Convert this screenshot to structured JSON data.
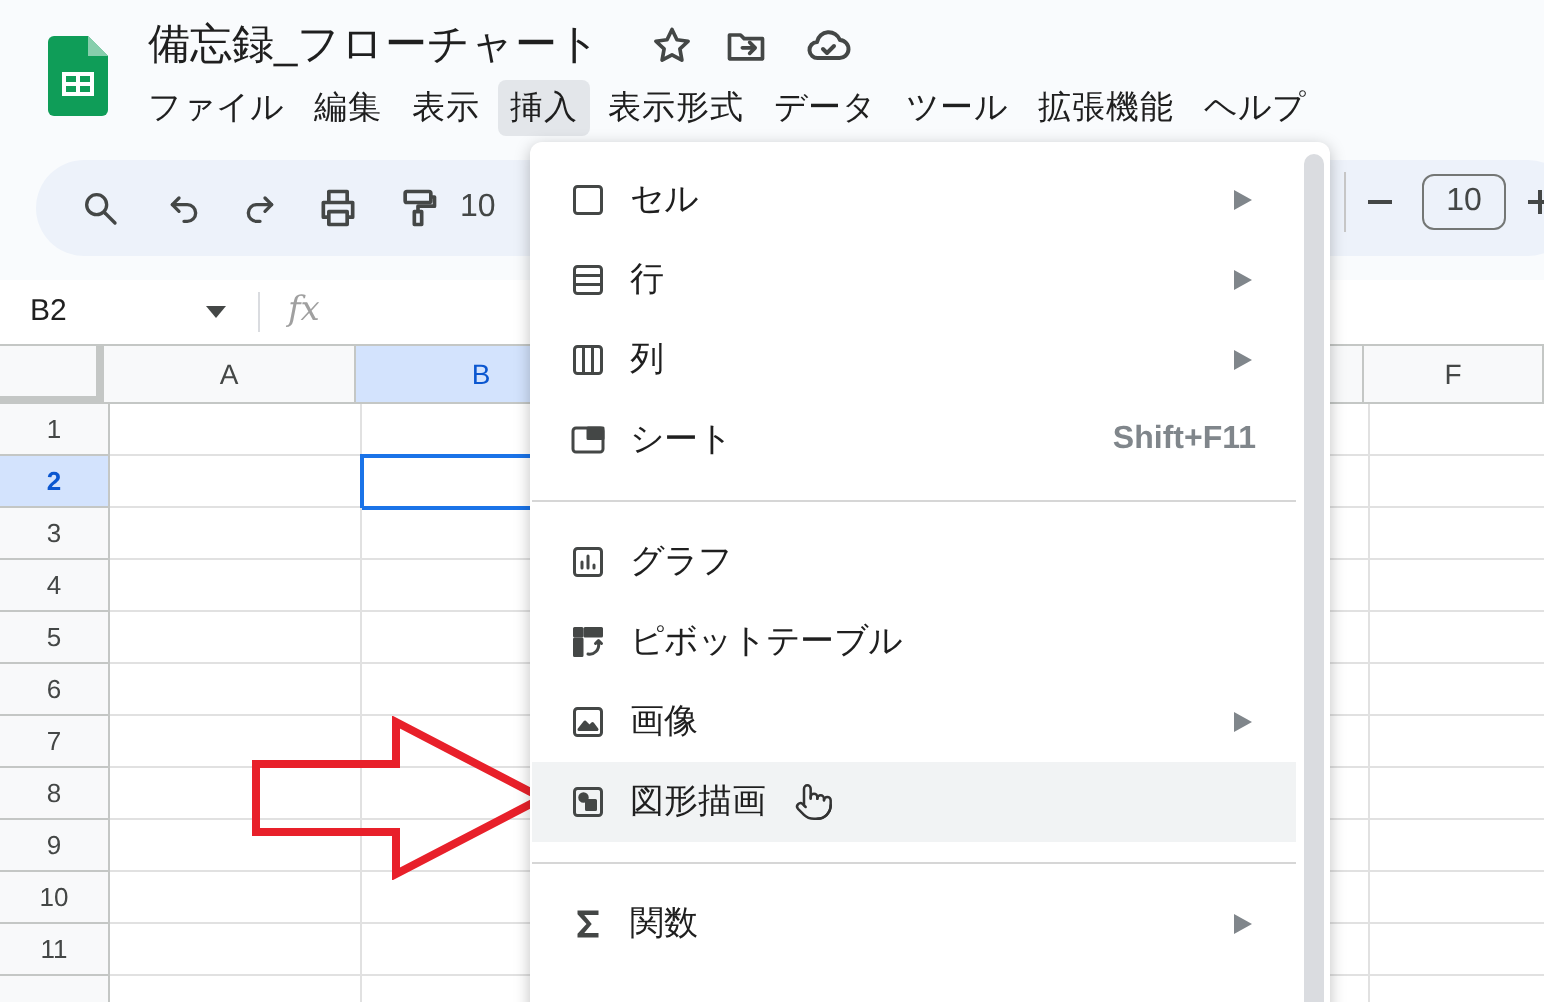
{
  "document": {
    "title": "備忘録_フローチャート"
  },
  "menu_bar": [
    {
      "label": "ファイル",
      "selected": false
    },
    {
      "label": "編集",
      "selected": false
    },
    {
      "label": "表示",
      "selected": false
    },
    {
      "label": "挿入",
      "selected": true
    },
    {
      "label": "表示形式",
      "selected": false
    },
    {
      "label": "データ",
      "selected": false
    },
    {
      "label": "ツール",
      "selected": false
    },
    {
      "label": "拡張機能",
      "selected": false
    },
    {
      "label": "ヘルプ",
      "selected": false
    }
  ],
  "toolbar": {
    "zoom": "10",
    "font_size": "10"
  },
  "formula_bar": {
    "name_box": "B2",
    "fx": "fx"
  },
  "sheet": {
    "columns": [
      {
        "label": "A",
        "selected": false
      },
      {
        "label": "B",
        "selected": true
      },
      {
        "label": "F",
        "selected": false
      }
    ],
    "rows": [
      {
        "label": "1",
        "selected": false
      },
      {
        "label": "2",
        "selected": true
      },
      {
        "label": "3",
        "selected": false
      },
      {
        "label": "4",
        "selected": false
      },
      {
        "label": "5",
        "selected": false
      },
      {
        "label": "6",
        "selected": false
      },
      {
        "label": "7",
        "selected": false
      },
      {
        "label": "8",
        "selected": false
      },
      {
        "label": "9",
        "selected": false
      },
      {
        "label": "10",
        "selected": false
      },
      {
        "label": "11",
        "selected": false
      }
    ]
  },
  "insert_menu": {
    "sections": [
      [
        {
          "label": "セル",
          "submenu": true,
          "highlighted": false
        },
        {
          "label": "行",
          "submenu": true,
          "highlighted": false
        },
        {
          "label": "列",
          "submenu": true,
          "highlighted": false
        },
        {
          "label": "シート",
          "shortcut": "Shift+F11",
          "submenu": false,
          "highlighted": false
        }
      ],
      [
        {
          "label": "グラフ",
          "submenu": false,
          "highlighted": false
        },
        {
          "label": "ピボットテーブル",
          "submenu": false,
          "highlighted": false
        },
        {
          "label": "画像",
          "submenu": true,
          "highlighted": false
        },
        {
          "label": "図形描画",
          "submenu": false,
          "highlighted": true
        }
      ],
      [
        {
          "label": "関数",
          "submenu": true,
          "highlighted": false
        }
      ]
    ]
  }
}
